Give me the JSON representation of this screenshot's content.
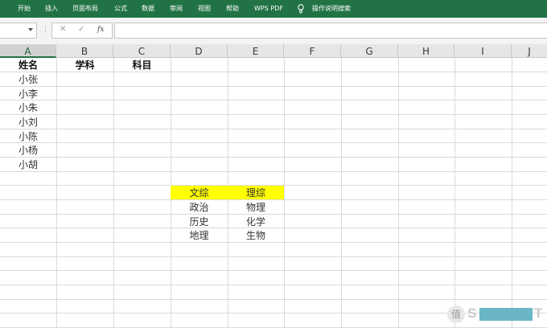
{
  "ribbon": {
    "tabs": [
      "开始",
      "插入",
      "页面布局",
      "公式",
      "数据",
      "审阅",
      "视图",
      "帮助",
      "WPS PDF"
    ],
    "search_label": "操作说明搜索",
    "search_icon": "lightbulb-icon",
    "bg_color": "#217346"
  },
  "formula_bar": {
    "name_box": "",
    "dots": "⋮",
    "cancel": "✕",
    "confirm": "✓",
    "fx": "fx",
    "formula": ""
  },
  "columns": [
    "A",
    "B",
    "C",
    "D",
    "E",
    "F",
    "G",
    "H",
    "I",
    "J"
  ],
  "sheet": {
    "headers": {
      "A1": "姓名",
      "B1": "学科",
      "C1": "科目"
    },
    "names": [
      "小张",
      "小李",
      "小朱",
      "小刘",
      "小陈",
      "小杨",
      "小胡"
    ],
    "table": {
      "head": [
        "文综",
        "理综"
      ],
      "rows": [
        [
          "政治",
          "物理"
        ],
        [
          "历史",
          "化学"
        ],
        [
          "地理",
          "生物"
        ]
      ],
      "highlight_color": "#ffff00"
    }
  },
  "watermark": {
    "circle_char": "值",
    "s": "S",
    "t": "T"
  }
}
